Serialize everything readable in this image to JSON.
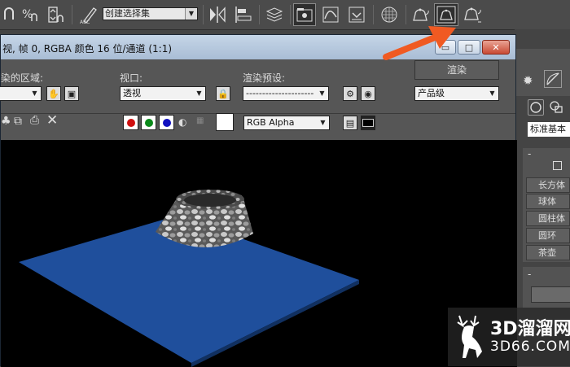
{
  "main_toolbar": {
    "selection_set": {
      "value": "创建选择集",
      "icon": "chevron-down-icon"
    },
    "buttons": [
      "snaps-toggle-icon",
      "percent-snap-icon",
      "spinner-snap-icon",
      "edit-named-selection-icon",
      "mirror-icon",
      "align-icon",
      "layer-manager-icon",
      "scene-explorer-icon",
      "curve-editor-icon",
      "schematic-view-icon",
      "material-editor-icon",
      "render-setup-icon",
      "rendered-frame-window-icon",
      "render-production-icon"
    ]
  },
  "render_window": {
    "title": "视, 帧 0, RGBA 颜色 16 位/通道 (1:1)",
    "area_label": "染的区域:",
    "viewport_label": "视口:",
    "viewport_value": "透视",
    "preset_label": "渲染预设:",
    "preset_value": "---------------------",
    "render_button": "渲染",
    "quality_value": "产品级",
    "channel_value": "RGB Alpha",
    "win_minimize": "▭",
    "win_maximize": "□",
    "win_close": "✕"
  },
  "right_panel": {
    "category_value": "标准基本",
    "object_buttons": [
      "长方体",
      "球体",
      "圆柱体",
      "圆环",
      "茶壶"
    ],
    "rollout_minus_1": "-",
    "rollout_minus_2": "-"
  },
  "watermark": {
    "line1": "3D溜溜网",
    "line2": "3D66.COM"
  },
  "colors": {
    "plane": "#1f4f9c",
    "annotation_arrow": "#f05a22",
    "titlebar": "#b8c9dc"
  }
}
